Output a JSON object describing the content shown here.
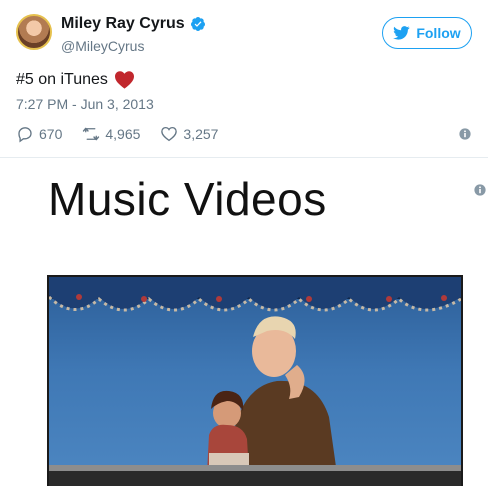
{
  "tweet": {
    "display_name": "Miley Ray Cyrus",
    "handle": "@MileyCyrus",
    "follow_label": "Follow",
    "text": "#5 on iTunes",
    "timestamp": "7:27 PM - Jun 3, 2013",
    "actions": {
      "replies": "670",
      "retweets": "4,965",
      "likes": "3,257"
    }
  },
  "card": {
    "title": "Music Videos"
  },
  "colors": {
    "twitter_blue": "#1da1f2",
    "muted_text": "#657786",
    "heart_red": "#c1272d"
  },
  "icons": [
    "verified-badge-icon",
    "twitter-bird-icon",
    "red-heart-emoji-icon",
    "reply-icon",
    "retweet-icon",
    "like-icon",
    "info-icon"
  ]
}
